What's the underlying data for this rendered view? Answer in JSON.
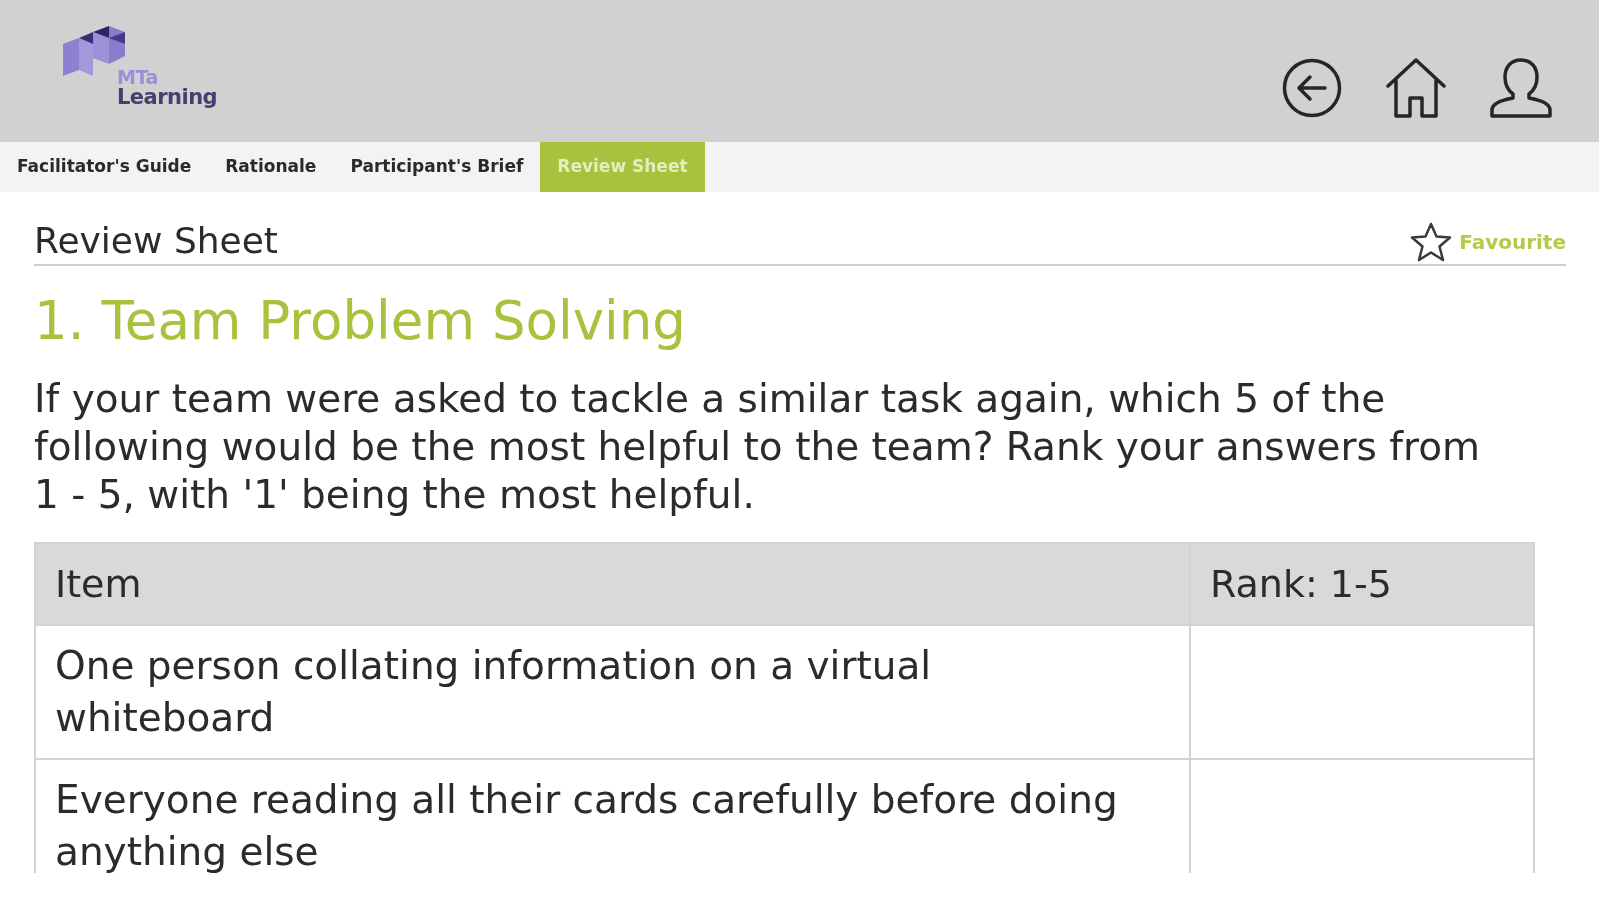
{
  "logo": {
    "line_1": "MTa",
    "line_2": "Learning"
  },
  "tabs": [
    {
      "label": "Facilitator's Guide",
      "selected": false
    },
    {
      "label": "Rationale",
      "selected": false
    },
    {
      "label": "Participant's Brief",
      "selected": false
    },
    {
      "label": "Review Sheet",
      "selected": true
    }
  ],
  "page_title": "Review Sheet",
  "favourite": {
    "label": "Favourite",
    "on": false
  },
  "heading": "1. Team Problem Solving",
  "instructions": "If your team were asked to tackle a similar task again, which 5 of the following would be the most helpful to the team? Rank your answers from 1 - 5, with '1' being the most helpful.",
  "table": {
    "columns": [
      "Item",
      "Rank: 1-5"
    ],
    "rows": [
      {
        "item": "One person collating information on a virtual whiteboard"
      },
      {
        "item": "Everyone reading all their cards carefully before doing anything else"
      }
    ]
  }
}
